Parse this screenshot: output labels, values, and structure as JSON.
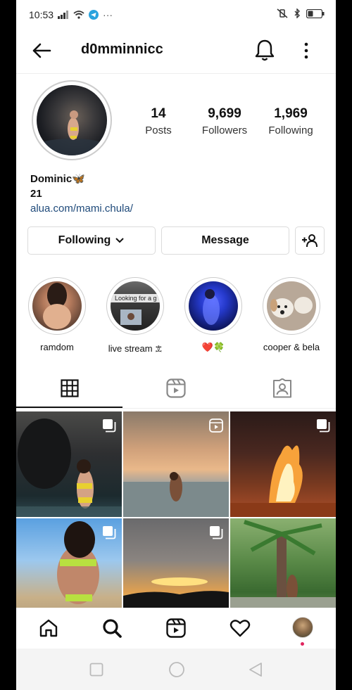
{
  "status": {
    "time": "10:53",
    "extra": "···"
  },
  "header": {
    "username": "d0mminnicc"
  },
  "profile": {
    "posts_count": "14",
    "posts_label": "Posts",
    "followers_count": "9,699",
    "followers_label": "Followers",
    "following_count": "1,969",
    "following_label": "Following",
    "name": "Dominic🦋",
    "age": "21",
    "link": "alua.com/mami.chula/"
  },
  "actions": {
    "following_label": "Following",
    "message_label": "Message"
  },
  "highlights": [
    {
      "label": "ramdom"
    },
    {
      "label": "live stream 𖠊",
      "overlay": "Looking for a g"
    },
    {
      "label": "❤️🍀"
    },
    {
      "label": "cooper & bela"
    }
  ],
  "tabs": [
    "grid-icon",
    "reels-icon",
    "tagged-icon"
  ],
  "nav": [
    "home-icon",
    "search-icon",
    "reels-icon",
    "heart-icon",
    "profile-avatar"
  ],
  "colors": {
    "link": "#1f4a7a",
    "text": "#111111",
    "border": "#dbdbdb",
    "notification_dot": "#e0245e"
  }
}
